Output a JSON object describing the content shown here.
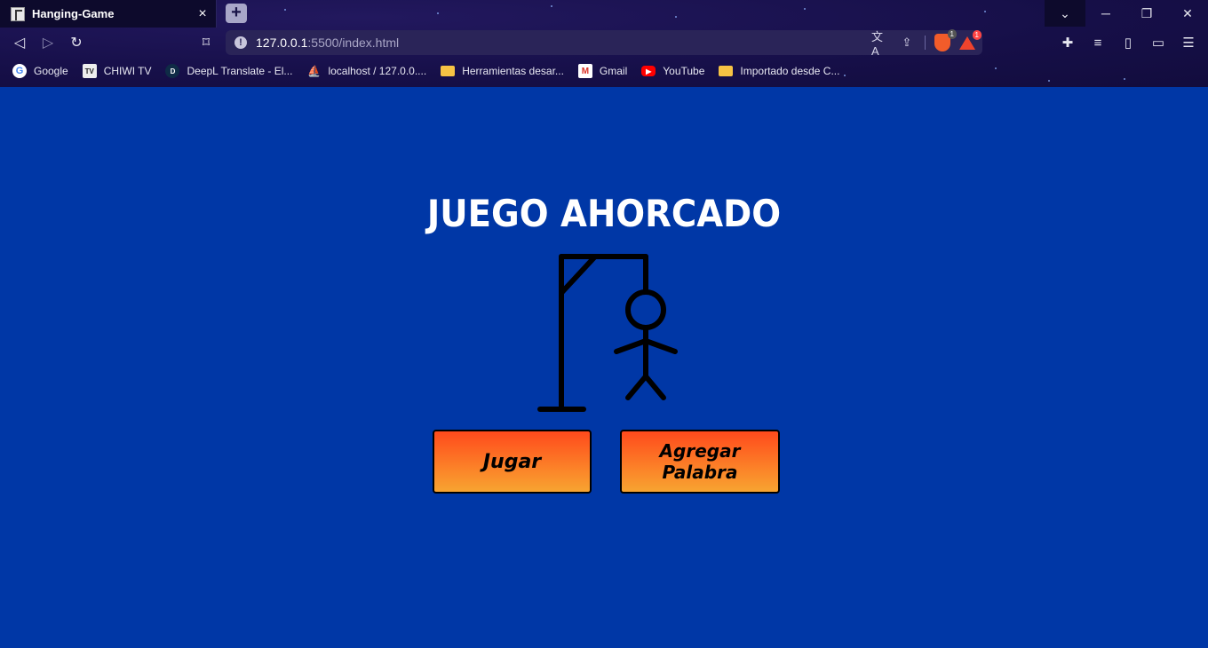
{
  "browser": {
    "tab_title": "Hanging-Game",
    "tab_close": "×",
    "new_tab": "+",
    "url_host": "127.0.0.1",
    "url_rest": ":5500/index.html",
    "brave_badge": "1",
    "rewards_badge": "1",
    "bookmarks": [
      {
        "label": "Google",
        "icon": "google-icon"
      },
      {
        "label": "CHIWI TV",
        "icon": "tv-icon"
      },
      {
        "label": "DeepL Translate - El...",
        "icon": "deepl-icon"
      },
      {
        "label": "localhost / 127.0.0....",
        "icon": "phpmyadmin-icon"
      },
      {
        "label": "Herramientas desar...",
        "icon": "folder-icon"
      },
      {
        "label": "Gmail",
        "icon": "gmail-icon"
      },
      {
        "label": "YouTube",
        "icon": "youtube-icon"
      },
      {
        "label": "Importado desde C...",
        "icon": "folder-icon"
      }
    ]
  },
  "page": {
    "title": "JUEGO AHORCADO",
    "play_button": "Jugar",
    "add_word_button": "Agregar Palabra",
    "background_color": "#0037a6",
    "button_gradient": [
      "#ff4a1c",
      "#f7a431"
    ]
  }
}
